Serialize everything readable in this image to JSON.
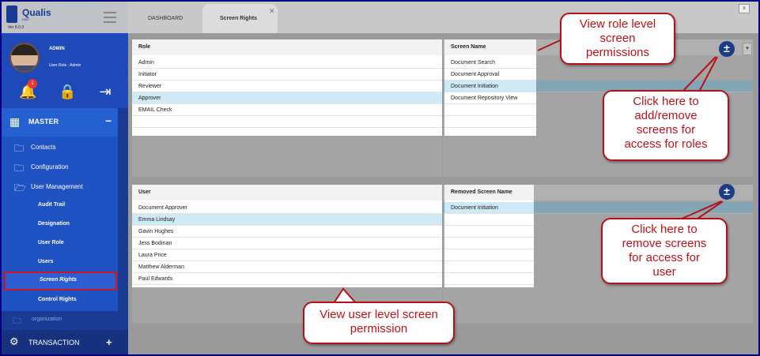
{
  "brand": {
    "name": "Qualis",
    "sub": "DMS",
    "version": "Ver 8.0.3"
  },
  "profile": {
    "name": "ADMIN",
    "role": "User Role : Admin",
    "notification_count": "1"
  },
  "sidebar": {
    "master_label": "MASTER",
    "master_toggle": "−",
    "items": [
      {
        "label": "Contacts"
      },
      {
        "label": "Configuration"
      },
      {
        "label": "User Management"
      }
    ],
    "sub_items": [
      {
        "label": "Audit Trail"
      },
      {
        "label": "Designation"
      },
      {
        "label": "User Role"
      },
      {
        "label": "Users"
      },
      {
        "label": "Screen Rights"
      },
      {
        "label": "Control Rights"
      }
    ],
    "organization_label": "organization",
    "transaction_label": "TRANSACTION",
    "transaction_toggle": "+"
  },
  "tabs": [
    {
      "label": "DASHBOARD"
    },
    {
      "label": "Screen Rights"
    }
  ],
  "window_close": "x",
  "role_table": {
    "header": "Role",
    "rows": [
      "Admin",
      "Initiator",
      "Reviewer",
      "Approver",
      "EMAIL Check"
    ],
    "selected": "Approver"
  },
  "screen_table": {
    "header": "Screen Name",
    "rows": [
      "Document Search",
      "Document Approval",
      "Document Initiation",
      "Document Repository View"
    ],
    "selected": "Document Initiation"
  },
  "user_table": {
    "header": "User",
    "rows": [
      "Document Approver",
      "Emma Lindsay",
      "Gavin Hughes",
      "Jess Bodman",
      "Laura Price",
      "Matthew Alderman",
      "Paul Edwards"
    ],
    "selected": "Emma Lindsay"
  },
  "removed_table": {
    "header": "Removed Screen Name",
    "rows": [
      "Document Initiation"
    ],
    "selected": "Document Initiation"
  },
  "buttons": {
    "role_plus": "±",
    "user_plus": "±"
  },
  "callouts": {
    "role_view": [
      "View role level",
      "screen",
      "permissions"
    ],
    "role_add": [
      "Click here to",
      "add/remove",
      "screens for",
      "access for roles"
    ],
    "user_remove": [
      "Click here to",
      "remove screens",
      "for access for",
      "user"
    ],
    "user_view": [
      "View user level screen",
      "permission"
    ]
  },
  "colors": {
    "sidebar": "#1a3b94",
    "menu": "#1f52c2",
    "highlight_border": "#d01720",
    "callout_text": "#c0111a",
    "selected_row": "#cfe9f7",
    "plus_button": "#1b3d88"
  },
  "icons": {
    "bell": "bell-icon",
    "lock": "lock-icon",
    "logout": "logout-icon",
    "folder": "folder-icon",
    "master": "grid-icon",
    "transaction": "transaction-icon"
  }
}
